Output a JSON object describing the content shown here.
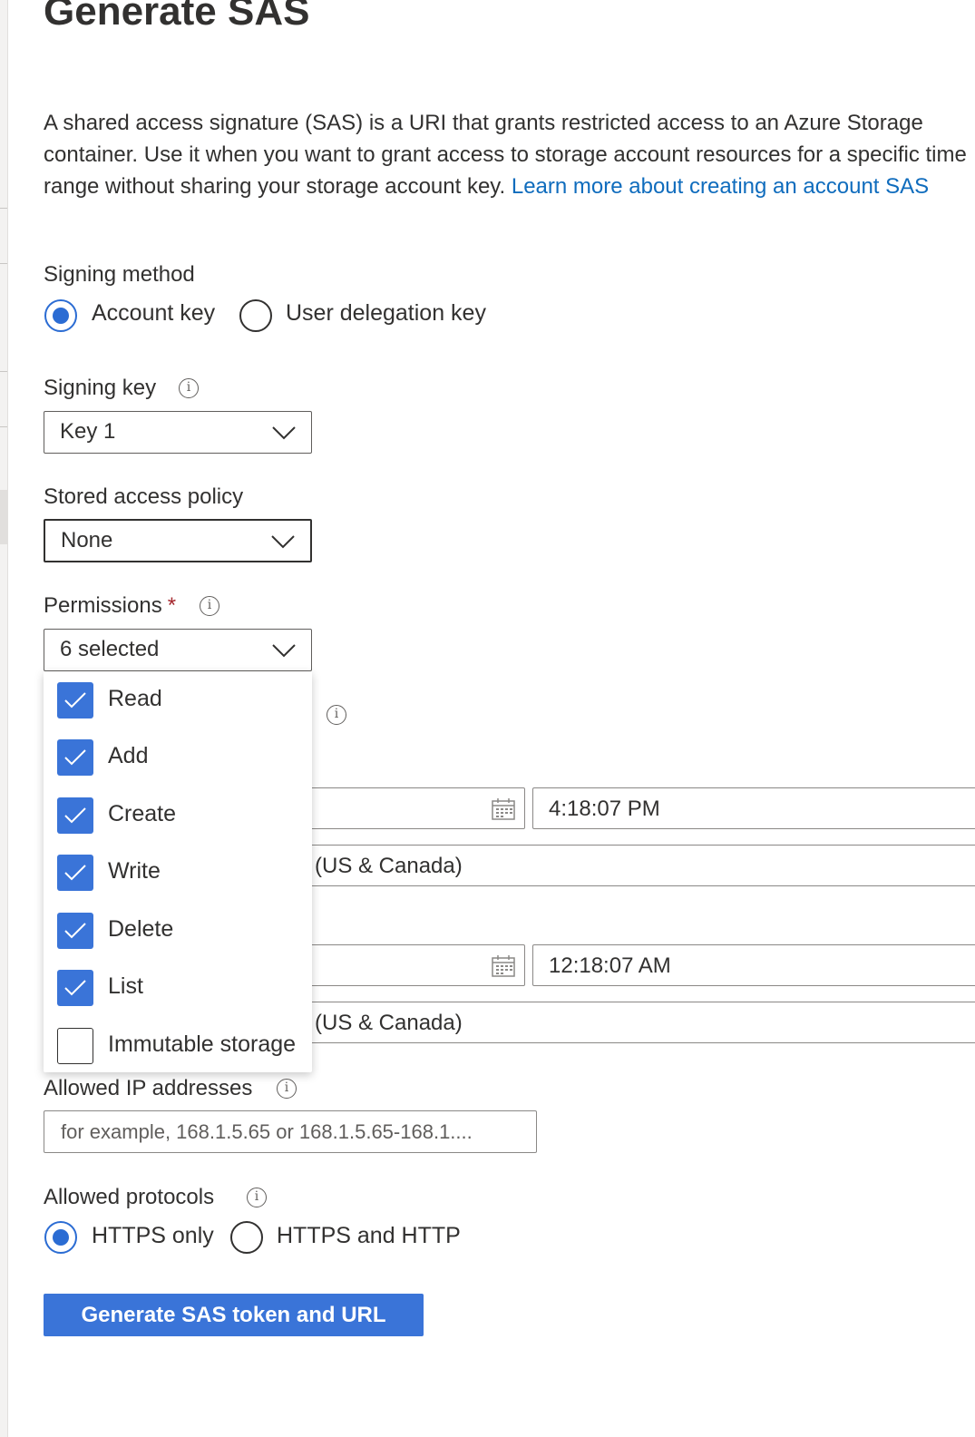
{
  "title": "Generate SAS",
  "description": {
    "text": "A shared access signature (SAS) is a URI that grants restricted access to an Azure Storage container. Use it when you want to grant access to storage account resources for a specific time range without sharing your storage account key.",
    "link_text": "Learn more about creating an account SAS"
  },
  "signing_method": {
    "label": "Signing method",
    "options": [
      "Account key",
      "User delegation key"
    ],
    "selected": "Account key"
  },
  "signing_key": {
    "label": "Signing key",
    "value": "Key 1"
  },
  "stored_access_policy": {
    "label": "Stored access policy",
    "value": "None"
  },
  "permissions": {
    "label": "Permissions",
    "required_mark": "*",
    "value": "6 selected",
    "options": [
      {
        "label": "Read",
        "checked": true
      },
      {
        "label": "Add",
        "checked": true
      },
      {
        "label": "Create",
        "checked": true
      },
      {
        "label": "Write",
        "checked": true
      },
      {
        "label": "Delete",
        "checked": true
      },
      {
        "label": "List",
        "checked": true
      },
      {
        "label": "Immutable storage",
        "checked": false
      }
    ]
  },
  "start": {
    "time": "4:18:07 PM",
    "timezone": "(US & Canada)"
  },
  "expiry": {
    "time": "12:18:07 AM",
    "timezone": "(US & Canada)"
  },
  "allowed_ip": {
    "label": "Allowed IP addresses",
    "placeholder": "for example, 168.1.5.65 or 168.1.5.65-168.1...."
  },
  "allowed_protocols": {
    "label": "Allowed protocols",
    "options": [
      "HTTPS only",
      "HTTPS and HTTP"
    ],
    "selected": "HTTPS only"
  },
  "generate_button": "Generate SAS token and URL",
  "icons": {
    "info": "info-icon",
    "chevron": "chevron-down-icon",
    "calendar": "calendar-icon",
    "check": "checkmark-icon"
  },
  "colors": {
    "accent": "#3a74d8",
    "link": "#0f6cbd",
    "required": "#a4262c"
  }
}
